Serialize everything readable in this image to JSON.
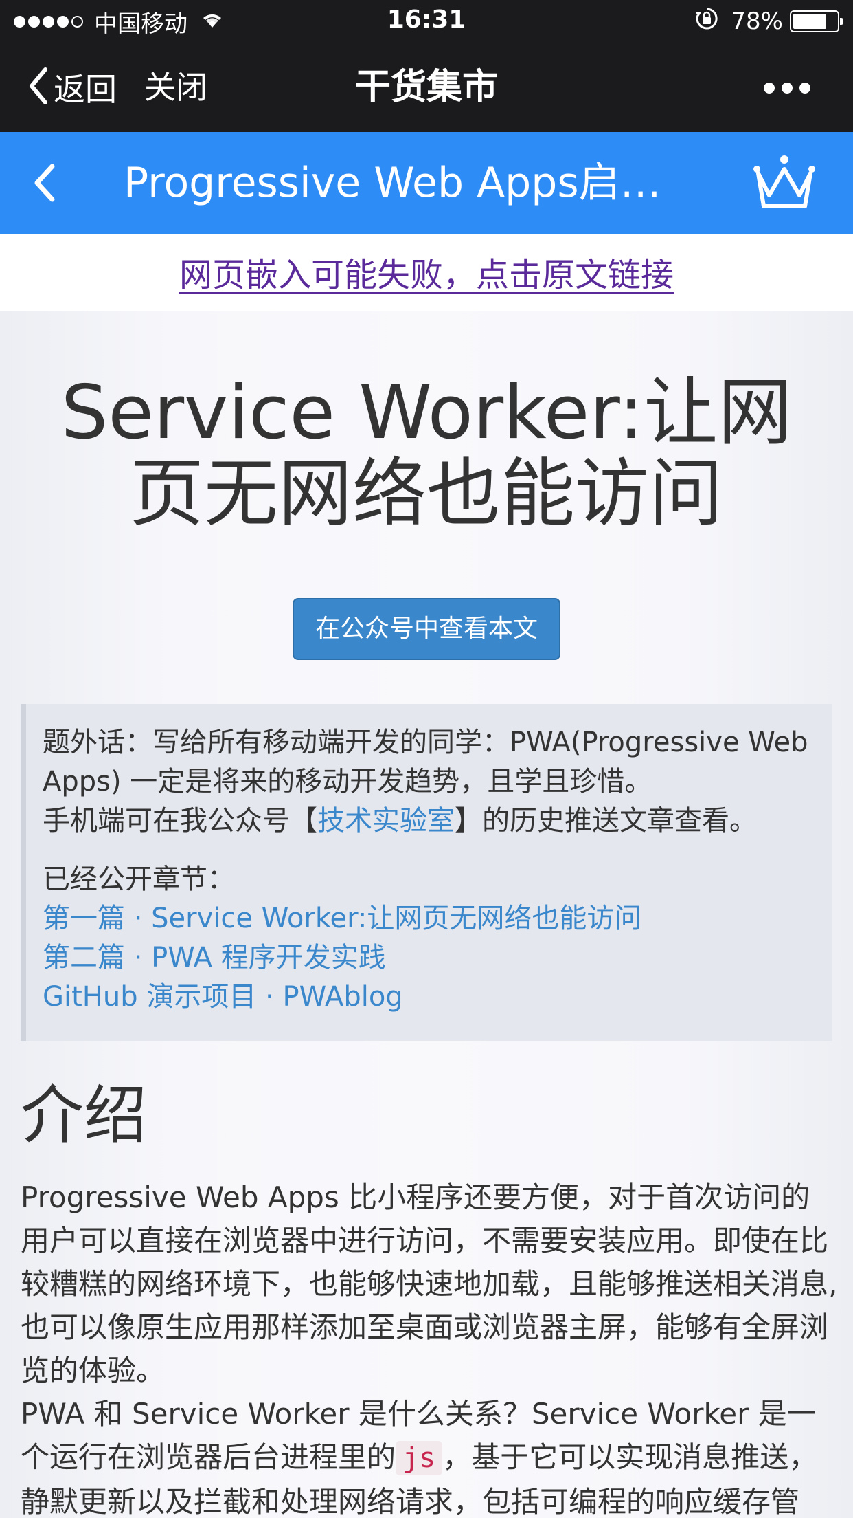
{
  "status_bar": {
    "carrier": "中国移动",
    "time": "16:31",
    "battery_pct": "78%",
    "battery_level": 0.78,
    "signal_bars": 4,
    "signal_total": 5
  },
  "wechat_nav": {
    "back_label": "返回",
    "close_label": "关闭",
    "title": "干货集市"
  },
  "app_header": {
    "title": "Progressive Web Apps启…"
  },
  "embed_notice": {
    "text": "网页嵌入可能失败，点击原文链接"
  },
  "article": {
    "title": "Service Worker:让网页无网络也能访问",
    "view_button": "在公众号中查看本文",
    "note": {
      "line1_prefix": "题外话：写给所有移动端开发的同学：PWA(Progressive Web Apps) 一定是将来的移动开发趋势，且学且珍惜。",
      "line2_prefix": "手机端可在我公众号【",
      "line2_link": "技术实验室",
      "line2_suffix": "】的历史推送文章查看。",
      "chapters_label": "已经公开章节：",
      "links": [
        "第一篇 · Service Worker:让网页无网络也能访问",
        "第二篇 · PWA 程序开发实践",
        "GitHub 演示项目 · PWAblog"
      ]
    },
    "section_heading": "介绍",
    "para1": "Progressive Web Apps 比小程序还要方便，对于首次访问的用户可以直接在浏览器中进行访问，不需要安装应用。即使在比较糟糕的网络环境下，也能够快速地加载，且能够推送相关消息, 也可以像原生应用那样添加至桌面或浏览器主屏，能够有全屏浏览的体验。",
    "para2_prefix": "PWA 和 Service Worker 是什么关系？Service Worker 是一个运行在浏览器后台进程里的",
    "para2_code": "js",
    "para2_suffix": "，基于它可以实现消息推送，静默更新以及拦截和处理网络请求，包括可编程的响应缓存管理。"
  },
  "icons": {
    "wifi": "wifi-icon",
    "rotation_lock": "rotation-lock-icon",
    "back": "chevron-left-icon",
    "more": "more-dots-icon",
    "crown": "crown-icon"
  },
  "colors": {
    "system_bar": "#1b1b1e",
    "app_header": "#2d8cf5",
    "button": "#3a87cc",
    "link": "#3a87cc",
    "visited_link": "#5a2a9a",
    "code": "#c7254e"
  }
}
